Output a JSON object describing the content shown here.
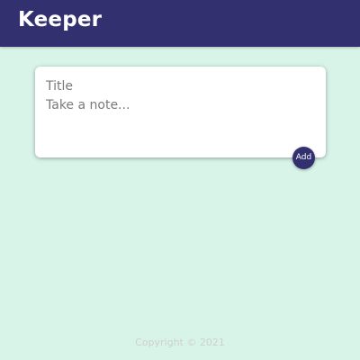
{
  "header": {
    "title": "Keeper"
  },
  "note_form": {
    "title_placeholder": "Title",
    "title_value": "",
    "content_placeholder": "Take a note...",
    "content_value": "",
    "add_label": "Add"
  },
  "footer": {
    "copyright": "Copyright © 2021"
  },
  "colors": {
    "header_bg": "#32306f",
    "page_bg": "#d8f4e9",
    "accent": "#32306f"
  }
}
